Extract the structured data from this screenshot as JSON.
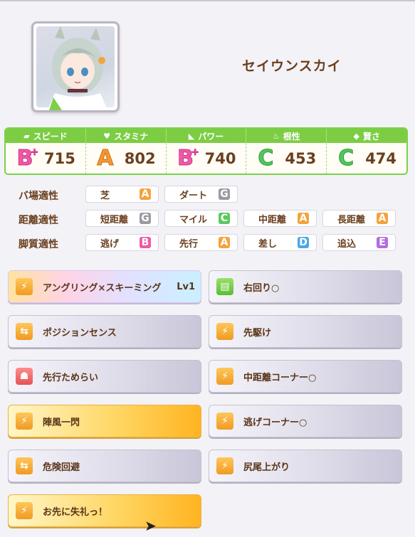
{
  "character": {
    "name": "セイウンスカイ"
  },
  "stats": [
    {
      "label": "スピード",
      "icon": "shoe-icon",
      "grade": "B",
      "plus": true,
      "value": "715"
    },
    {
      "label": "スタミナ",
      "icon": "heart-icon",
      "grade": "A",
      "plus": false,
      "value": "802"
    },
    {
      "label": "パワー",
      "icon": "muscle-icon",
      "grade": "B",
      "plus": true,
      "value": "740"
    },
    {
      "label": "根性",
      "icon": "flame-icon",
      "grade": "C",
      "plus": false,
      "value": "453"
    },
    {
      "label": "賢さ",
      "icon": "graduation-cap-icon",
      "grade": "C",
      "plus": false,
      "value": "474"
    }
  ],
  "aptitude": {
    "track": {
      "label": "バ場適性",
      "items": [
        {
          "name": "芝",
          "grade": "A"
        },
        {
          "name": "ダート",
          "grade": "G"
        }
      ]
    },
    "distance": {
      "label": "距離適性",
      "items": [
        {
          "name": "短距離",
          "grade": "G"
        },
        {
          "name": "マイル",
          "grade": "C"
        },
        {
          "name": "中距離",
          "grade": "A"
        },
        {
          "name": "長距離",
          "grade": "A"
        }
      ]
    },
    "style": {
      "label": "脚質適性",
      "items": [
        {
          "name": "逃げ",
          "grade": "B"
        },
        {
          "name": "先行",
          "grade": "A"
        },
        {
          "name": "差し",
          "grade": "D"
        },
        {
          "name": "追込",
          "grade": "E"
        }
      ]
    }
  },
  "skills": [
    {
      "name": "アングリング×スキーミング",
      "level": "Lv1",
      "style": "rainbow",
      "icon": "runner-icon"
    },
    {
      "name": "右回り○",
      "level": "",
      "style": "normal",
      "icon": "course-icon"
    },
    {
      "name": "ポジションセンス",
      "level": "",
      "style": "normal",
      "icon": "position-icon"
    },
    {
      "name": "先駆け",
      "level": "",
      "style": "normal",
      "icon": "runner-icon"
    },
    {
      "name": "先行ためらい",
      "level": "",
      "style": "normal",
      "icon": "debuff-icon"
    },
    {
      "name": "中距離コーナー○",
      "level": "",
      "style": "normal",
      "icon": "runner-icon"
    },
    {
      "name": "陣風一閃",
      "level": "",
      "style": "gold",
      "icon": "runner-icon"
    },
    {
      "name": "逃げコーナー○",
      "level": "",
      "style": "normal",
      "icon": "runner-icon"
    },
    {
      "name": "危険回避",
      "level": "",
      "style": "normal",
      "icon": "position-icon"
    },
    {
      "name": "尻尾上がり",
      "level": "",
      "style": "normal",
      "icon": "runner-icon"
    },
    {
      "name": "お先に失礼っ！",
      "level": "",
      "style": "gold",
      "icon": "runner-icon"
    }
  ]
}
